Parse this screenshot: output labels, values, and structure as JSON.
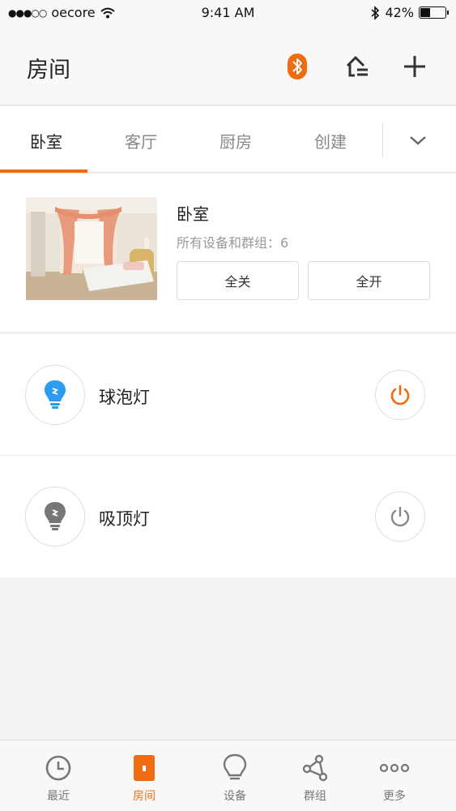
{
  "status_bar": {
    "carrier": "oecore",
    "time": "9:41 AM",
    "battery": "42%",
    "battery_level": 0.42
  },
  "header": {
    "title": "房间",
    "bluetooth_icon": "bluetooth-icon",
    "home_icon": "home-settings-icon",
    "add_icon": "plus-icon"
  },
  "tabs": [
    {
      "label": "卧室",
      "active": true
    },
    {
      "label": "客厅",
      "active": false
    },
    {
      "label": "厨房",
      "active": false
    },
    {
      "label": "创建",
      "active": false
    }
  ],
  "room": {
    "name": "卧室",
    "subtitle": "所有设备和群组：6",
    "all_off": "全关",
    "all_on": "全开"
  },
  "devices": [
    {
      "name": "球泡灯",
      "color": "#2c9cf0",
      "power": "on"
    },
    {
      "name": "吸顶灯",
      "color": "#777777",
      "power": "off"
    }
  ],
  "bottom_nav": [
    {
      "label": "最近",
      "icon": "clock-icon",
      "active": false
    },
    {
      "label": "房间",
      "icon": "room-icon",
      "active": true
    },
    {
      "label": "设备",
      "icon": "bulb-icon",
      "active": false
    },
    {
      "label": "群组",
      "icon": "share-nodes-icon",
      "active": false
    },
    {
      "label": "更多",
      "icon": "more-dots-icon",
      "active": false
    }
  ],
  "colors": {
    "accent": "#f06c12",
    "bulb_on": "#2c9cf0",
    "bulb_off": "#777777"
  }
}
